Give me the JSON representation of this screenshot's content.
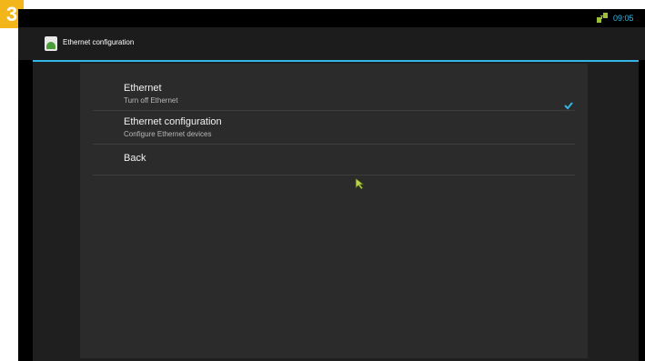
{
  "step_badge": "3",
  "status_bar": {
    "time": "09:05",
    "network_icon": "ethernet-connected-icon"
  },
  "action_bar": {
    "title": "Ethernet configuration",
    "app_icon": "settings-app-icon"
  },
  "list": [
    {
      "title": "Ethernet",
      "subtitle": "Turn off Ethernet",
      "checked": true
    },
    {
      "title": "Ethernet configuration",
      "subtitle": "Configure Ethernet devices"
    },
    {
      "title": "Back"
    }
  ],
  "colors": {
    "accent": "#33b5e5",
    "badge": "#f2b61b",
    "cursor": "#b8d24a"
  }
}
